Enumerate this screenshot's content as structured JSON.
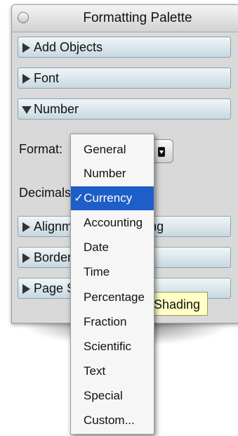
{
  "window": {
    "title": "Formatting Palette"
  },
  "sections": {
    "add_objects": "Add Objects",
    "font": "Font",
    "number": "Number",
    "alignment": "Alignment and Spacing",
    "borders": "Borders and Shading",
    "page_setup": "Page Setup"
  },
  "number": {
    "format_label": "Format:",
    "decimals_label": "Decimals:"
  },
  "tooltip": "Shading",
  "menu": {
    "items": [
      "General",
      "Number",
      "Currency",
      "Accounting",
      "Date",
      "Time",
      "Percentage",
      "Fraction",
      "Scientific",
      "Text",
      "Special",
      "Custom..."
    ],
    "selected_index": 2,
    "checkmark": "✓"
  },
  "colors": {
    "selection": "#1e5ec8",
    "tooltip": "#ffffc6"
  }
}
